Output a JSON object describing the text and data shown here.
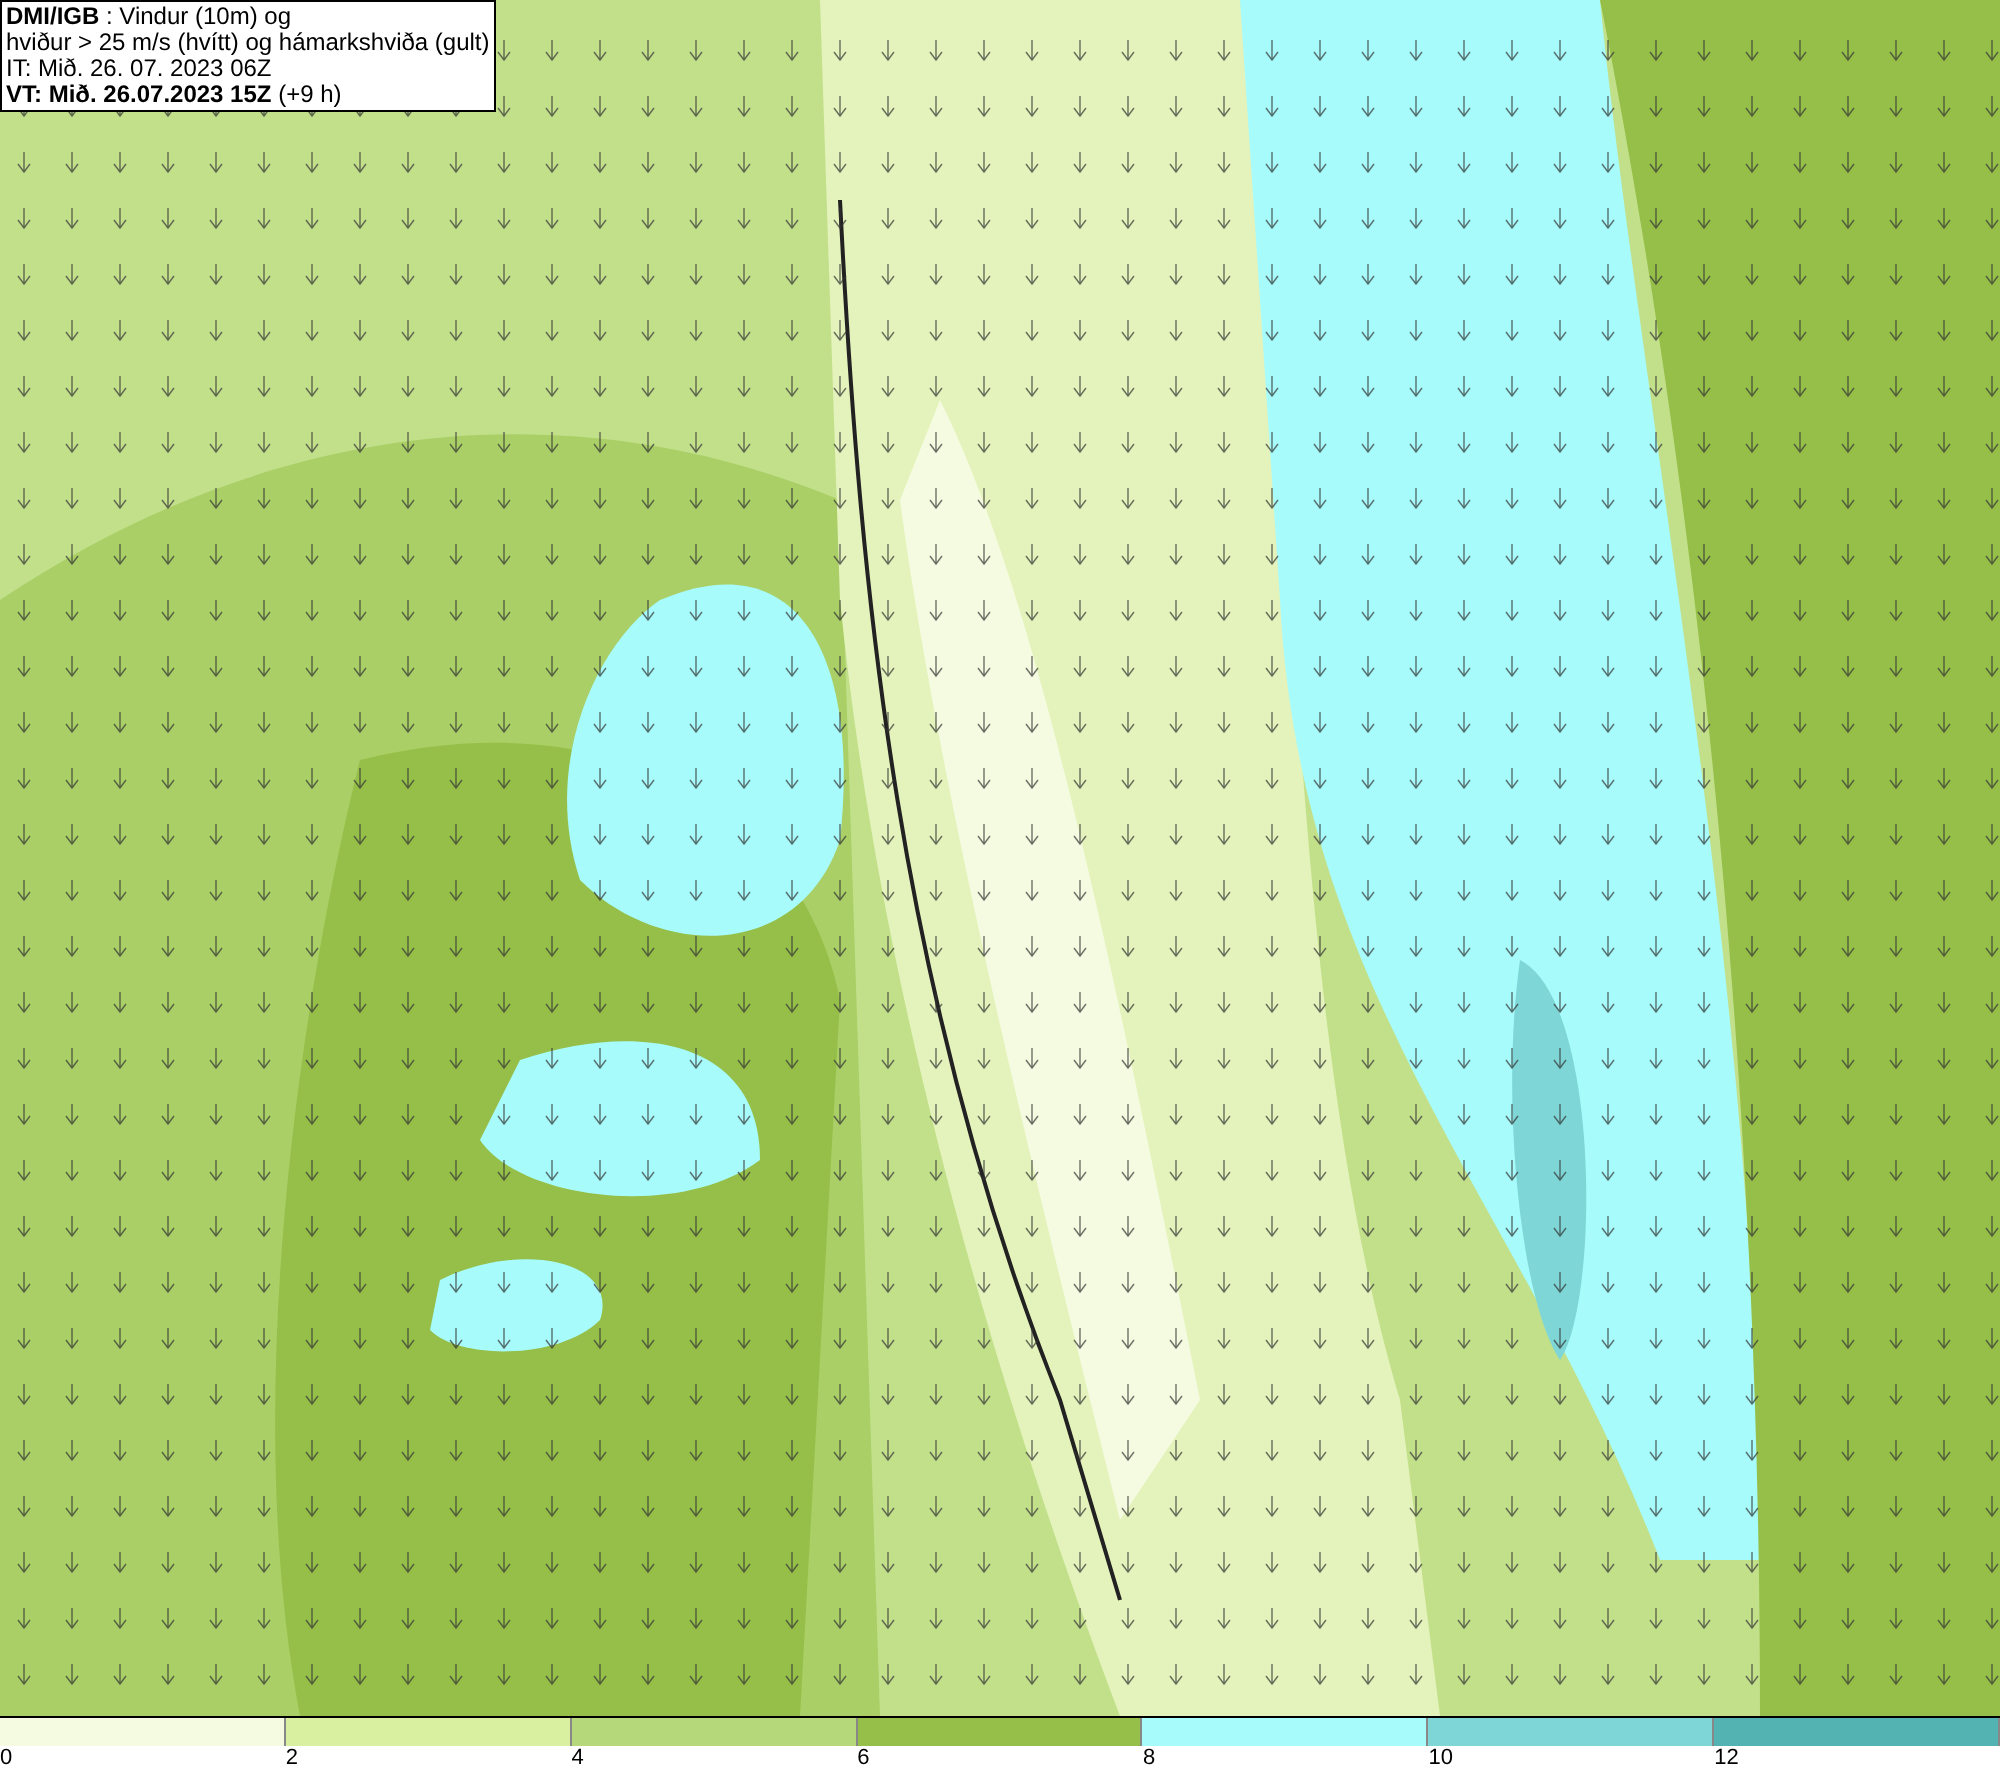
{
  "title_box": {
    "lines": [
      "**DMI/IGB** : Vindur (10m) og",
      "hviður > 25 m/s (hvítt) og hámarkshviða (gult)",
      "IT: Mið. 26. 07. 2023 06Z",
      "**VT: Mið. 26.07.2023 15Z** (+9 h)"
    ]
  },
  "legend": {
    "segments": [
      {
        "color": "#f5fbe1",
        "label": "0"
      },
      {
        "color": "#d8f0a0",
        "label": "2"
      },
      {
        "color": "#b5d97a",
        "label": "4"
      },
      {
        "color": "#95bf48",
        "label": "6"
      },
      {
        "color": "#a8fbfb",
        "label": "8"
      },
      {
        "color": "#7ed6d6",
        "label": "10"
      },
      {
        "color": "#53b3b3",
        "label": "12"
      }
    ]
  }
}
